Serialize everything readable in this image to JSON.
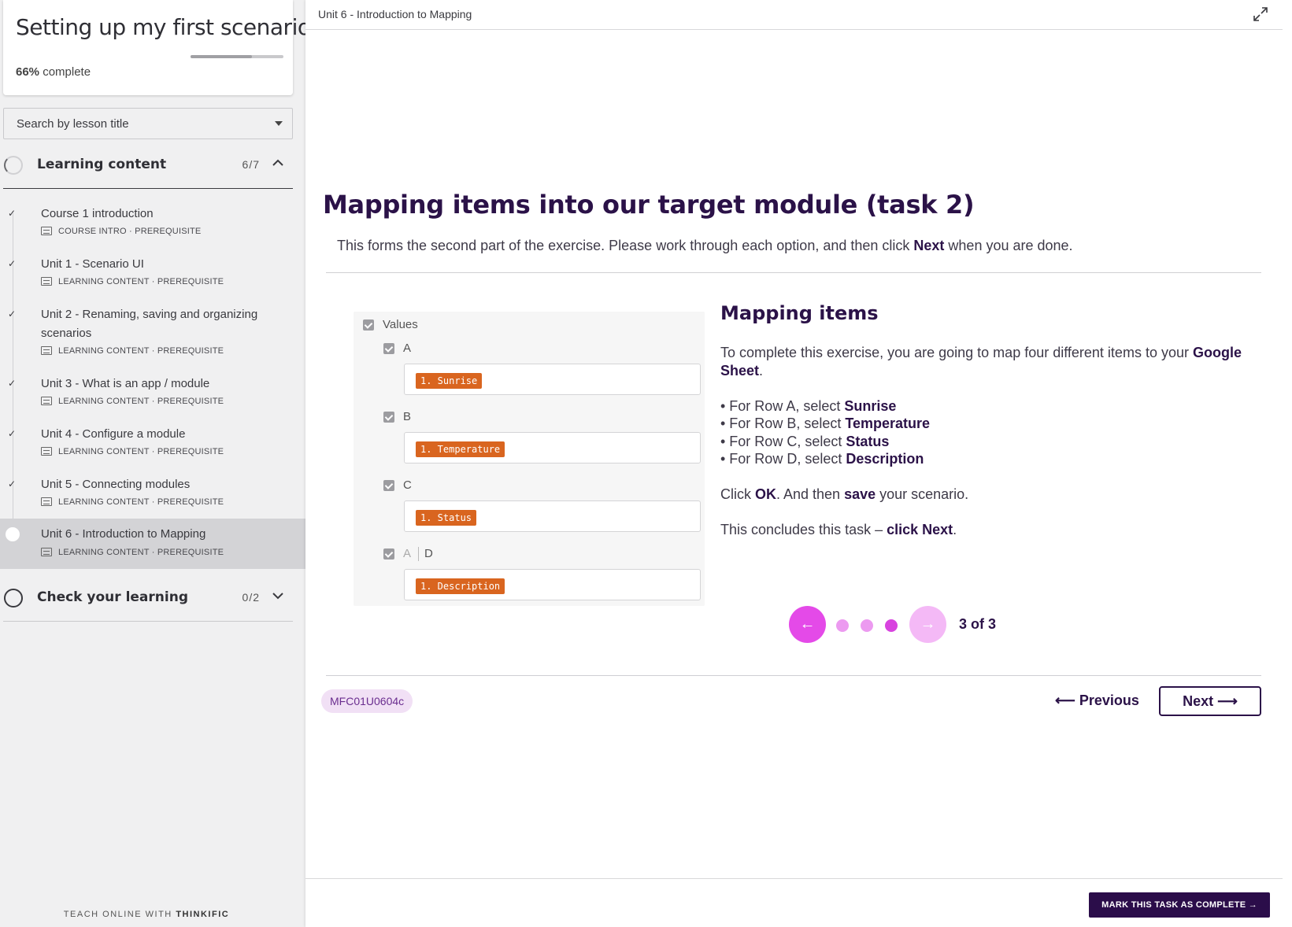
{
  "course": {
    "title": "Setting up my first scenario",
    "progress_percent": "66%",
    "progress_value": 0.66,
    "progress_suffix": "complete"
  },
  "search": {
    "placeholder": "Search by lesson title"
  },
  "chapters": [
    {
      "title": "Learning content",
      "count": "6/7",
      "expanded": true
    },
    {
      "title": "Check your learning",
      "count": "0/2",
      "expanded": false
    }
  ],
  "lessons": [
    {
      "title": "Course 1 introduction",
      "type": "COURSE INTRO",
      "tag": "PREREQUISITE",
      "icon": "document-icon",
      "done": true
    },
    {
      "title": "Unit 1 - Scenario UI",
      "type": "LEARNING CONTENT",
      "tag": "PREREQUISITE",
      "icon": "presentation-icon",
      "done": true
    },
    {
      "title": "Unit 2 - Renaming, saving and organizing scenarios",
      "type": "LEARNING CONTENT",
      "tag": "PREREQUISITE",
      "icon": "presentation-icon",
      "done": true
    },
    {
      "title": "Unit 3 - What is an app / module",
      "type": "LEARNING CONTENT",
      "tag": "PREREQUISITE",
      "icon": "presentation-icon",
      "done": true
    },
    {
      "title": "Unit 4 - Configure a module",
      "type": "LEARNING CONTENT",
      "tag": "PREREQUISITE",
      "icon": "presentation-icon",
      "done": true
    },
    {
      "title": "Unit 5 - Connecting modules",
      "type": "LEARNING CONTENT",
      "tag": "PREREQUISITE",
      "icon": "presentation-icon",
      "done": true
    },
    {
      "title": "Unit 6 - Introduction to Mapping",
      "type": "LEARNING CONTENT",
      "tag": "PREREQUISITE",
      "icon": "presentation-icon",
      "done": false,
      "active": true
    }
  ],
  "separator": "·",
  "footer_brand": {
    "prefix": "TEACH ONLINE WITH",
    "brand": "THINKIFIC"
  },
  "topbar": {
    "breadcrumb": "Unit 6 - Introduction to Mapping"
  },
  "lesson": {
    "heading": "Mapping items into our target module (task 2)",
    "intro_before": "This forms the second part of the exercise. Please work through each option, and then click ",
    "intro_bold": "Next",
    "intro_after": " when you are done."
  },
  "mapping_panel": {
    "root_label": "Values",
    "rows": [
      {
        "label": "A",
        "label_prefix": "",
        "pill": "1. Sunrise"
      },
      {
        "label": "B",
        "label_prefix": "",
        "pill": "1. Temperature"
      },
      {
        "label": "C",
        "label_prefix": "",
        "pill": "1. Status"
      },
      {
        "label": "D",
        "label_prefix": "A",
        "pill": "1. Description"
      }
    ],
    "pill_color": "#d9651f"
  },
  "step": {
    "title": "Mapping items",
    "p1_before": "To complete this exercise, you are going to map four different items to your ",
    "p1_bold": "Google Sheet",
    "p1_after": ".",
    "bullets": [
      {
        "text": "• For Row A, select ",
        "bold": "Sunrise"
      },
      {
        "text": "• For Row B, select ",
        "bold": "Temperature"
      },
      {
        "text": "• For Row C, select ",
        "bold": "Status"
      },
      {
        "text": "• For Row D, select ",
        "bold": "Description"
      }
    ],
    "p3": {
      "t1": "Click ",
      "b1": "OK",
      "t2": ". And then ",
      "b2": "save",
      "t3": " your scenario."
    },
    "p4": {
      "t1": "This concludes this task – ",
      "b1": "click Next",
      "t2": "."
    }
  },
  "carousel": {
    "current": 3,
    "total": 3,
    "label": "3 of 3",
    "prev_icon": "arrow-left-icon",
    "next_icon": "arrow-right-icon",
    "accent": "#d843df"
  },
  "nav": {
    "code": "MFC01U0604c",
    "previous_label": "Previous",
    "next_label": "Next",
    "complete_label": "MARK THIS TASK AS COMPLETE"
  },
  "colors": {
    "heading": "#2b1248",
    "complete_button": "#2b0d4a",
    "badge_bg": "#f1e0f5"
  }
}
